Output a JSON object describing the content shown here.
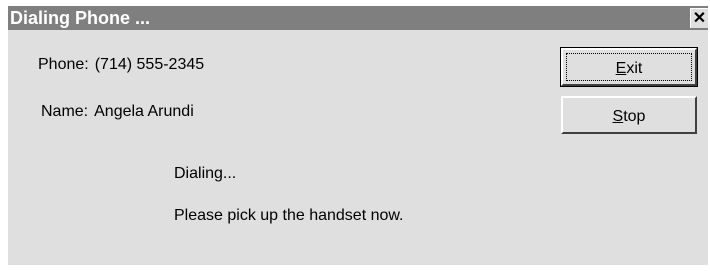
{
  "window": {
    "title": "Dialing Phone ...",
    "close_glyph": "✕"
  },
  "contact": {
    "phone_label": "Phone:",
    "phone_value": "(714) 555-2345",
    "name_label": "Name:",
    "name_value": "Angela Arundi"
  },
  "buttons": {
    "exit_mnemonic": "E",
    "exit_rest": "xit",
    "stop_mnemonic": "S",
    "stop_rest": "top"
  },
  "status": {
    "line1": "Dialing...",
    "line2": "Please pick up the handset now."
  },
  "colors": {
    "titlebar": "#7f7f7f",
    "window_bg": "#dfdfdf"
  }
}
